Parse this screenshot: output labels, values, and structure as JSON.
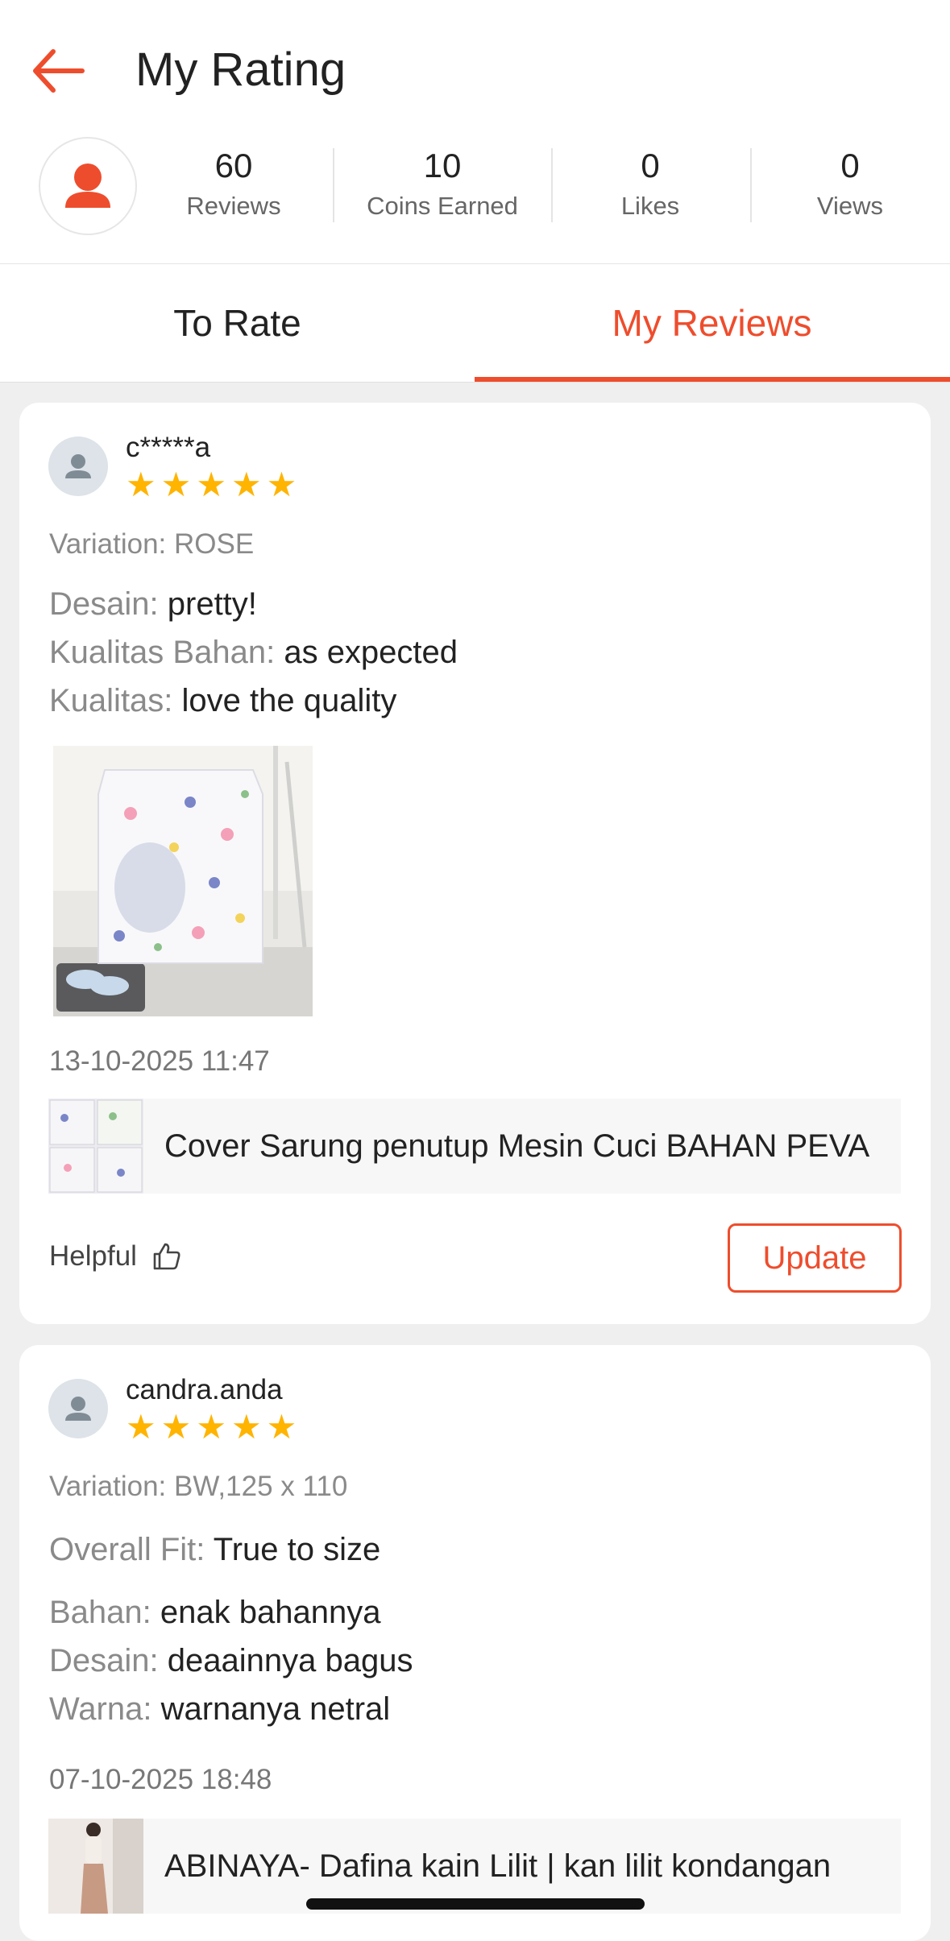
{
  "header": {
    "title": "My Rating"
  },
  "stats": [
    {
      "value": "60",
      "label": "Reviews"
    },
    {
      "value": "10",
      "label": "Coins Earned"
    },
    {
      "value": "0",
      "label": "Likes"
    },
    {
      "value": "0",
      "label": "Views"
    }
  ],
  "tabs": [
    {
      "label": "To Rate",
      "active": false
    },
    {
      "label": "My Reviews",
      "active": true
    }
  ],
  "colors": {
    "accent": "#ee4d2d",
    "star": "#ffb400"
  },
  "reviews": [
    {
      "username": "c*****a",
      "rating": 5,
      "variation": "Variation: ROSE",
      "attributes": [
        {
          "key": "Desain:",
          "value": "pretty!"
        },
        {
          "key": "Kualitas Bahan:",
          "value": "as expected"
        },
        {
          "key": "Kualitas:",
          "value": "love the quality"
        }
      ],
      "date": "13-10-2025 11:47",
      "product_name": "Cover Sarung penutup Mesin Cuci BAHAN PEVA",
      "helpful_label": "Helpful",
      "update_label": "Update"
    },
    {
      "username": "candra.anda",
      "rating": 5,
      "variation": "Variation: BW,125 x 110",
      "fit": {
        "key": "Overall Fit:",
        "value": "True to size"
      },
      "attributes": [
        {
          "key": "Bahan:",
          "value": "enak bahannya"
        },
        {
          "key": "Desain:",
          "value": "deaainnya bagus"
        },
        {
          "key": "Warna:",
          "value": "warnanya netral"
        }
      ],
      "date": "07-10-2025 18:48",
      "product_name": "ABINAYA- Dafina kain Lilit  | kan lilit kondangan"
    }
  ]
}
